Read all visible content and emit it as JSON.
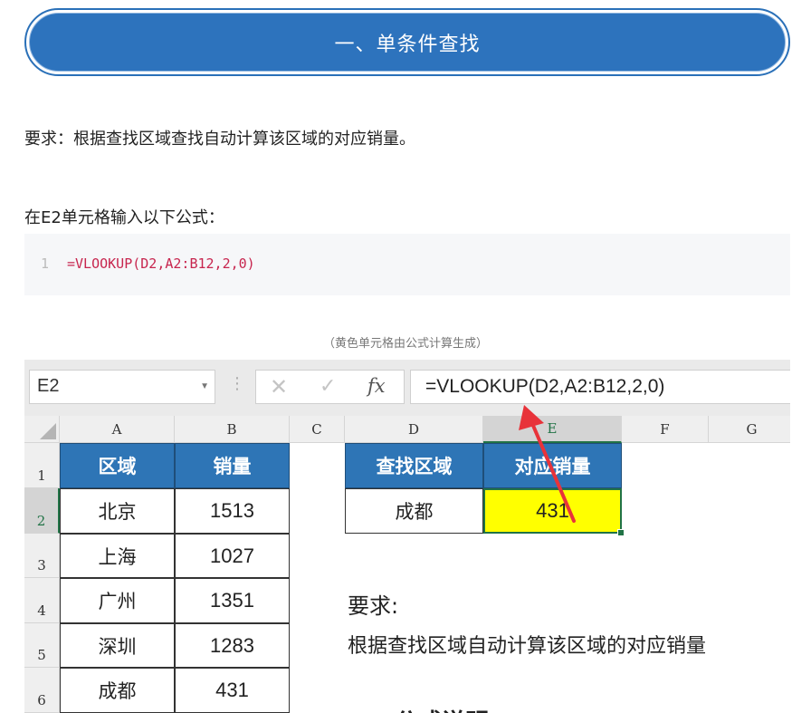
{
  "banner": {
    "title": "一、单条件查找"
  },
  "requirement_text": "要求：根据查找区域查找自动计算该区域的对应销量。",
  "instruction_text": "在E2单元格输入以下公式：",
  "code": {
    "line_number": "1",
    "formula": "=VLOOKUP(D2,A2:B12,2,0)"
  },
  "caption": "（黄色单元格由公式计算生成）",
  "excel": {
    "name_box": "E2",
    "formula_bar": "=VLOOKUP(D2,A2:B12,2,0)",
    "fx_label": "fx",
    "columns": [
      "A",
      "B",
      "C",
      "D",
      "E",
      "F",
      "G"
    ],
    "rows": [
      "1",
      "2",
      "3",
      "4",
      "5",
      "6"
    ],
    "table_headers": {
      "a": "区域",
      "b": "销量",
      "d": "查找区域",
      "e": "对应销量"
    },
    "table_rows": [
      {
        "region": "北京",
        "sales": "1513"
      },
      {
        "region": "上海",
        "sales": "1027"
      },
      {
        "region": "广州",
        "sales": "1351"
      },
      {
        "region": "深圳",
        "sales": "1283"
      },
      {
        "region": "成都",
        "sales": "431"
      }
    ],
    "lookup_region": "成都",
    "lookup_result": "431",
    "note_title": "要求:",
    "note_body": "根据查找区域自动计算该区域的对应销量",
    "next_heading": "一、公式说明",
    "selected_cell_color": "#ffff00",
    "header_color": "#2e75b6",
    "arrow_color": "#e8333a"
  }
}
